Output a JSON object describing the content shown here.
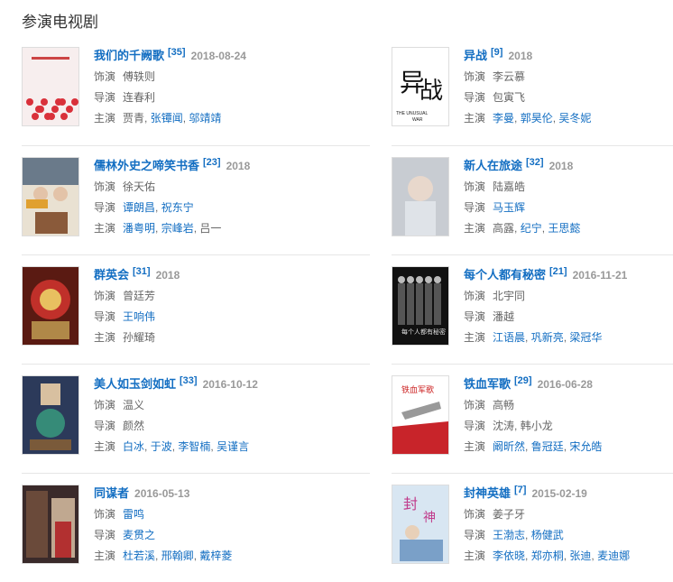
{
  "section_title": "参演电视剧",
  "labels": {
    "role": "饰演",
    "director": "导演",
    "cast": "主演"
  },
  "dramas": [
    {
      "title": "我们的千阙歌",
      "ref": "[35]",
      "date": "2018-08-24",
      "role": "傅轶则",
      "directors": [
        "连春利"
      ],
      "directors_linked": false,
      "cast": [
        "贾青",
        "张镡闻",
        "邬靖靖"
      ],
      "cast_linked": [
        false,
        true,
        true
      ]
    },
    {
      "title": "异战",
      "ref": "[9]",
      "date": "2018",
      "role": "李云慕",
      "directors": [
        "包寅飞"
      ],
      "directors_linked": false,
      "cast": [
        "李曼",
        "郭昊伦",
        "吴冬妮"
      ],
      "cast_linked": [
        true,
        true,
        true
      ]
    },
    {
      "title": "儒林外史之啼笑书香",
      "ref": "[23]",
      "date": "2018",
      "role": "徐天佑",
      "directors": [
        "谭朗昌",
        "祝东宁"
      ],
      "directors_linked": true,
      "cast": [
        "潘粤明",
        "宗峰岩",
        "吕一"
      ],
      "cast_linked": [
        true,
        true,
        false
      ]
    },
    {
      "title": "新人在旅途",
      "ref": "[32]",
      "date": "2018",
      "role": "陆嘉皓",
      "directors": [
        "马玉辉"
      ],
      "directors_linked": true,
      "cast": [
        "高露",
        "纪宁",
        "王思懿"
      ],
      "cast_linked": [
        false,
        true,
        true
      ]
    },
    {
      "title": "群英会",
      "ref": "[31]",
      "date": "2018",
      "role": "曾廷芳",
      "directors": [
        "王响伟"
      ],
      "directors_linked": true,
      "cast": [
        "孙耀琦"
      ],
      "cast_linked": [
        false
      ]
    },
    {
      "title": "每个人都有秘密",
      "ref": "[21]",
      "date": "2016-11-21",
      "role": "北宇同",
      "directors": [
        "潘越"
      ],
      "directors_linked": false,
      "cast": [
        "江语晨",
        "巩新亮",
        "梁冠华"
      ],
      "cast_linked": [
        true,
        true,
        true
      ]
    },
    {
      "title": "美人如玉剑如虹",
      "ref": "[33]",
      "date": "2016-10-12",
      "role": "温义",
      "directors": [
        "颜然"
      ],
      "directors_linked": false,
      "cast": [
        "白冰",
        "于波",
        "李智楠",
        "吴谨言"
      ],
      "cast_linked": [
        true,
        true,
        true,
        true
      ]
    },
    {
      "title": "铁血军歌",
      "ref": "[29]",
      "date": "2016-06-28",
      "role": "高畅",
      "directors": [
        "沈涛",
        "韩小龙"
      ],
      "directors_linked": false,
      "cast": [
        "阚昕然",
        "鲁冠廷",
        "宋允皓"
      ],
      "cast_linked": [
        true,
        true,
        true
      ]
    },
    {
      "title": "同谋者",
      "ref": "",
      "date": "2016-05-13",
      "role": "雷鸣",
      "role_linked": true,
      "directors": [
        "麦贯之"
      ],
      "directors_linked": true,
      "cast": [
        "杜若溪",
        "邢翰卿",
        "戴梓菱"
      ],
      "cast_linked": [
        true,
        true,
        true
      ]
    },
    {
      "title": "封神英雄",
      "ref": "[7]",
      "date": "2015-02-19",
      "role": "姜子牙",
      "directors": [
        "王渤志",
        "杨健武"
      ],
      "directors_linked": true,
      "cast": [
        "李依晓",
        "郑亦桐",
        "张迪",
        "麦迪娜"
      ],
      "cast_linked": [
        true,
        true,
        true,
        true
      ]
    }
  ],
  "poster_texts": {
    "p1": "异战",
    "p1_sub": "THE UNUSUAL WAR"
  }
}
